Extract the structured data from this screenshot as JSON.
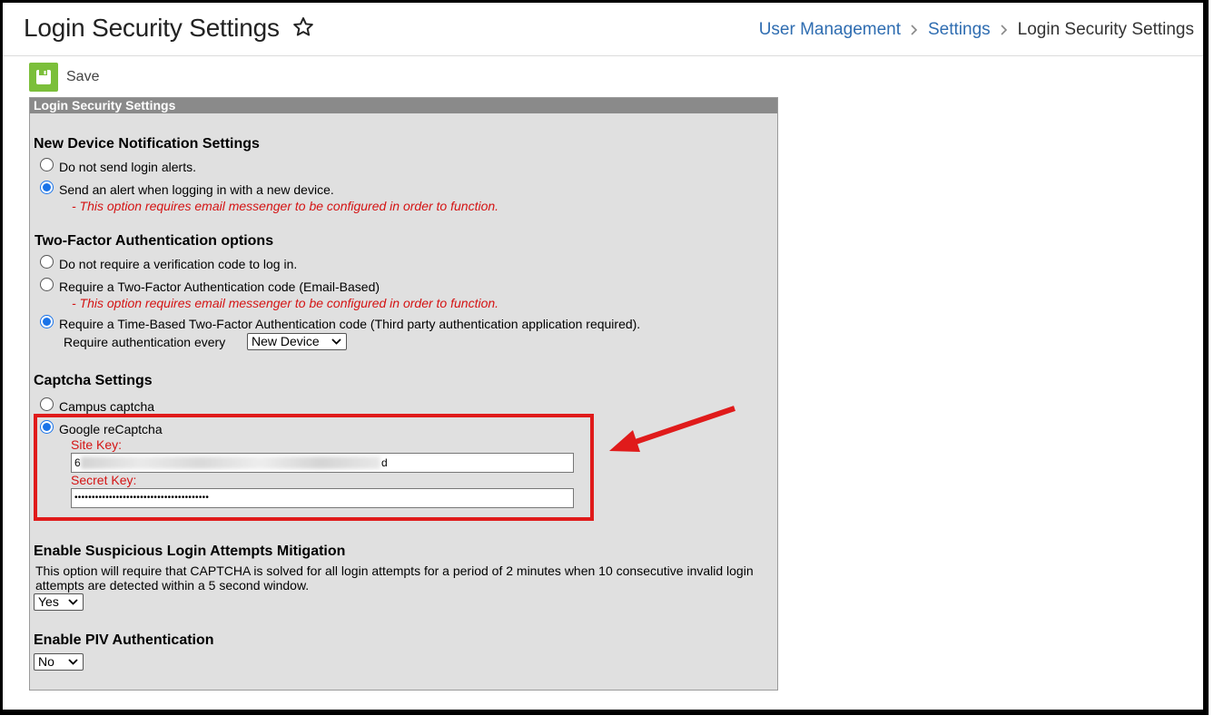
{
  "header": {
    "title": "Login Security Settings",
    "breadcrumb": [
      "User Management",
      "Settings",
      "Login Security Settings"
    ]
  },
  "toolbar": {
    "save_label": "Save"
  },
  "panel": {
    "title": "Login Security Settings",
    "new_device": {
      "title": "New Device Notification Settings",
      "options": [
        "Do not send login alerts.",
        "Send an alert when logging in with a new device."
      ],
      "selected": 1,
      "note": "- This option requires email messenger to be configured in order to function."
    },
    "two_factor": {
      "title": "Two-Factor Authentication options",
      "options": [
        "Do not require a verification code to log in.",
        "Require a Two-Factor Authentication code (Email-Based)",
        "Require a Time-Based Two-Factor Authentication code (Third party authentication application required)."
      ],
      "selected": 2,
      "note": "- This option requires email messenger to be configured in order to function.",
      "require_every_label": "Require authentication every",
      "require_every_value": "New Device"
    },
    "captcha": {
      "title": "Captcha Settings",
      "options": [
        "Campus captcha",
        "Google reCaptcha"
      ],
      "selected": 1,
      "site_key_label": "Site Key:",
      "site_key_value_start": "6",
      "site_key_value_end": "d",
      "secret_key_label": "Secret Key:",
      "secret_key_value": "•••••••••••••••••••••••••••••••••••••••"
    },
    "suspicious": {
      "title": "Enable Suspicious Login Attempts Mitigation",
      "description": "This option will require that CAPTCHA is solved for all login attempts for a period of 2 minutes when 10 consecutive invalid login attempts are detected within a 5 second window.",
      "value": "Yes"
    },
    "piv": {
      "title": "Enable PIV Authentication",
      "value": "No"
    }
  },
  "colors": {
    "accent": "#2f6db1",
    "save": "#7bbf3a",
    "warning": "#d41414",
    "highlight": "#e01b1b"
  }
}
